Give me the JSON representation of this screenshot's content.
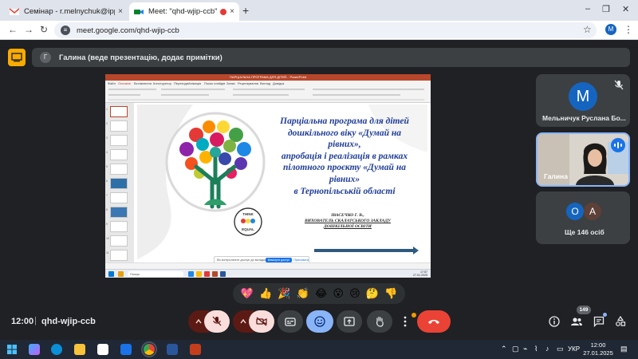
{
  "browser": {
    "tabs": [
      {
        "title": "Семінар - r.melnychuk@ippo.edu",
        "close": "×"
      },
      {
        "title": "Meet: \"qhd-wjip-ccb\"",
        "close": "×"
      }
    ],
    "new_tab": "+",
    "window_controls": {
      "minimize": "–",
      "restore": "❐",
      "close": "✕"
    },
    "nav": {
      "back": "←",
      "forward": "→",
      "reload": "↻"
    },
    "url": "meet.google.com/qhd-wjip-ccb",
    "profile_initial": "M",
    "star": "☆",
    "menu": "⋮"
  },
  "banner": {
    "avatar_initial": "Г",
    "text": "Галина (веде презентацію, додає примітки)"
  },
  "presentation": {
    "title_bar": "ПАРЦІАЛЬНА ПРОГРАМА ДЛЯ ДІТЕЙ... PowerPoint",
    "ribbon_tabs": [
      "Файл",
      "Основне",
      "Вставлення",
      "Конструктор",
      "Переходи",
      "Анімація",
      "Показ слайдів",
      "Запис",
      "Рецензування",
      "Вигляд",
      "Довідка"
    ],
    "slide_numbers": [
      "1",
      "2",
      "3",
      "4",
      "5",
      "6",
      "7",
      "8",
      "9",
      "10",
      "11"
    ],
    "slide_title": [
      "Парціальна програма для дітей",
      "дошкільного віку «Думай на",
      "рівних»,",
      "апробація і реалізація в рамках",
      "пілотного проєкту «Думай на",
      "рівних»",
      "в Тернопільській області"
    ],
    "author_name": "ІВАСЕЧКО Г. В.,",
    "author_line2": "ВИХОВАТЕЛЬ СКАЛАТСЬКОГО ЗАКЛАДУ",
    "author_line3": "ДОШКІЛЬНОЇ ОСВІТИ",
    "logo_top": "THINK",
    "logo_bottom": "EQUAL",
    "notification": "Ви контролюєте доступ до вкладки",
    "notification_btn": "Вимкнути доступ",
    "notification_btn2": "Приховати",
    "win_search": "Пошук",
    "win_time": "17:57",
    "win_date": "27.01.2025"
  },
  "participants": {
    "tile1": {
      "initial": "M",
      "name": "Мельничук Руслана Бо..."
    },
    "tile2": {
      "name": "Галина"
    },
    "tile3": {
      "initials": [
        "О",
        "А"
      ],
      "label": "Ще 146 осіб"
    }
  },
  "reactions": [
    "💖",
    "👍",
    "🎉",
    "👏",
    "😂",
    "😮",
    "😢",
    "🤔",
    "👎"
  ],
  "callbar": {
    "time": "12:00",
    "separator": "|",
    "code": "qhd-wjip-ccb",
    "participant_count": "149"
  },
  "taskbar": {
    "lang": "УКР",
    "time": "12:00",
    "date": "27.01.2025"
  },
  "colors": {
    "meet_bg": "#202124",
    "end_call": "#ea4335",
    "muted_control": "#f9dedc",
    "accent_blue": "#8ab4f8",
    "ppt_red": "#b7472a",
    "slide_title_blue": "#1f3d99"
  }
}
